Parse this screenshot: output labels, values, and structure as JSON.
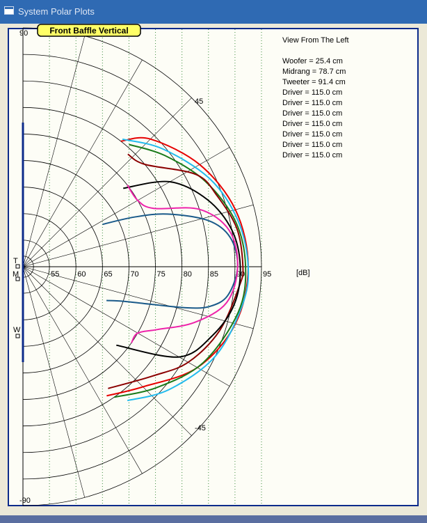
{
  "window": {
    "title": "System Polar Plots"
  },
  "plot": {
    "title": "Front Baffle Vertical",
    "view_label": "View From The Left",
    "unit_label": "[dB]",
    "angle_labels": {
      "top": "90",
      "upper_diag": "45",
      "lower_diag": "-45",
      "bottom": "-90"
    },
    "driver_markers": {
      "tweeter": "T",
      "midrange": "M",
      "woofer": "W"
    },
    "legend": [
      "Woofer = 25.4 cm",
      "Midrang = 78.7 cm",
      "Tweeter = 91.4 cm",
      "Driver = 115.0 cm",
      "Driver = 115.0 cm",
      "Driver = 115.0 cm",
      "Driver = 115.0 cm",
      "Driver = 115.0 cm",
      "Driver = 115.0 cm",
      "Driver = 115.0 cm"
    ],
    "colors": {
      "grid": "#000000",
      "dotted_grid": "#3a8a3a",
      "border": "#0b2a8a",
      "badge_fill": "#ffff66"
    }
  },
  "chart_data": {
    "type": "polar",
    "r_ticks": [
      55,
      60,
      65,
      70,
      75,
      80,
      85,
      90,
      95
    ],
    "r_range": [
      50,
      95
    ],
    "theta_range": [
      -90,
      90
    ],
    "series": [
      {
        "color": "#e60000",
        "points": [
          [
            -57,
            79
          ],
          [
            -45,
            82
          ],
          [
            -30,
            88
          ],
          [
            -15,
            91.5
          ],
          [
            0,
            92.5
          ],
          [
            15,
            91.5
          ],
          [
            30,
            88.5
          ],
          [
            45,
            84
          ],
          [
            52,
            80
          ]
        ]
      },
      {
        "color": "#22bbee",
        "points": [
          [
            -52,
            82
          ],
          [
            -40,
            86
          ],
          [
            -25,
            90
          ],
          [
            -10,
            92
          ],
          [
            0,
            92.5
          ],
          [
            12,
            91.5
          ],
          [
            25,
            89
          ],
          [
            40,
            84.5
          ],
          [
            52,
            80.5
          ]
        ]
      },
      {
        "color": "#1a7a1a",
        "points": [
          [
            -55,
            80
          ],
          [
            -42,
            84
          ],
          [
            -28,
            88.5
          ],
          [
            -12,
            91.5
          ],
          [
            0,
            92
          ],
          [
            12,
            91
          ],
          [
            25,
            88
          ],
          [
            38,
            84
          ],
          [
            49,
            80.5
          ]
        ]
      },
      {
        "color": "#8b0000",
        "points": [
          [
            -55,
            78
          ],
          [
            -40,
            82
          ],
          [
            -30,
            86
          ],
          [
            -18,
            89
          ],
          [
            -5,
            91
          ],
          [
            0,
            91.5
          ],
          [
            10,
            91
          ],
          [
            20,
            89
          ],
          [
            28,
            87
          ],
          [
            40,
            80
          ],
          [
            47,
            79
          ]
        ]
      },
      {
        "color": "#000000",
        "points": [
          [
            -40,
            73
          ],
          [
            -30,
            84
          ],
          [
            -20,
            88
          ],
          [
            -10,
            90.5
          ],
          [
            0,
            91
          ],
          [
            10,
            90
          ],
          [
            20,
            87
          ],
          [
            30,
            82
          ],
          [
            38,
            74
          ]
        ]
      },
      {
        "color": "#1a5a8a",
        "points": [
          [
            -22,
            67
          ],
          [
            -19,
            70
          ],
          [
            -16,
            76
          ],
          [
            -14,
            82
          ],
          [
            -12,
            86
          ],
          [
            -8,
            89
          ],
          [
            0,
            90.5
          ],
          [
            8,
            89.5
          ],
          [
            14,
            86
          ],
          [
            20,
            79
          ],
          [
            24,
            73
          ],
          [
            28,
            67
          ]
        ]
      },
      {
        "color": "#ee22aa",
        "points": [
          [
            -35,
            75
          ],
          [
            -30,
            75
          ],
          [
            -25,
            78
          ],
          [
            -18,
            84
          ],
          [
            -10,
            89
          ],
          [
            0,
            90.5
          ],
          [
            10,
            89.5
          ],
          [
            18,
            85
          ],
          [
            24,
            77
          ],
          [
            30,
            75
          ],
          [
            38,
            75
          ]
        ]
      }
    ]
  }
}
